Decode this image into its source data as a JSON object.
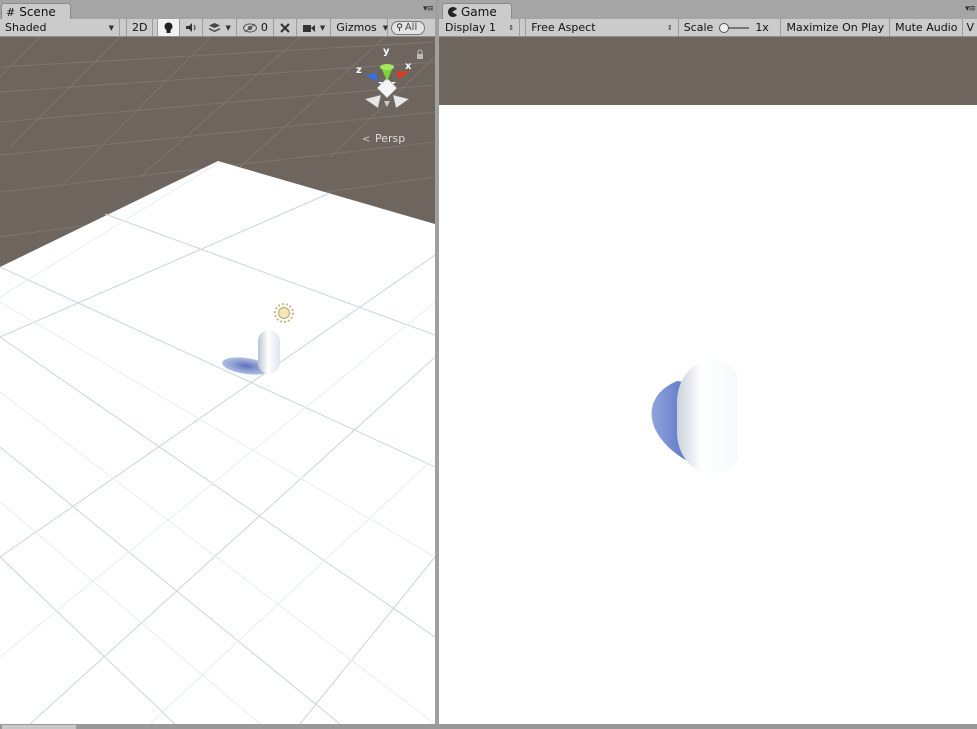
{
  "scene": {
    "tab_label": "Scene",
    "tab_icon": "grid-hash-icon",
    "toolbar": {
      "shading_mode": "Shaded",
      "mode_2d_label": "2D",
      "hidden_count": "0",
      "gizmos_label": "Gizmos",
      "search_placeholder": "All"
    },
    "gizmo": {
      "y_label": "y",
      "x_label": "x",
      "z_label": "z",
      "projection_label": "Persp"
    },
    "colors": {
      "sky": "#6e655f",
      "ground": "#ffffff",
      "grid": "#c9d6dc",
      "x_axis": "#e2391f",
      "y_axis": "#7dd43a",
      "z_axis": "#3b6fe0"
    }
  },
  "game": {
    "tab_label": "Game",
    "tab_icon": "pacman-icon",
    "toolbar": {
      "display_label": "Display 1",
      "aspect_label": "Free Aspect",
      "scale_label": "Scale",
      "scale_value": "1x",
      "maximize_label": "Maximize On Play",
      "mute_label": "Mute Audio",
      "stats_label": "V"
    },
    "colors": {
      "sky": "#6f6660",
      "ground": "#ffffff"
    }
  }
}
